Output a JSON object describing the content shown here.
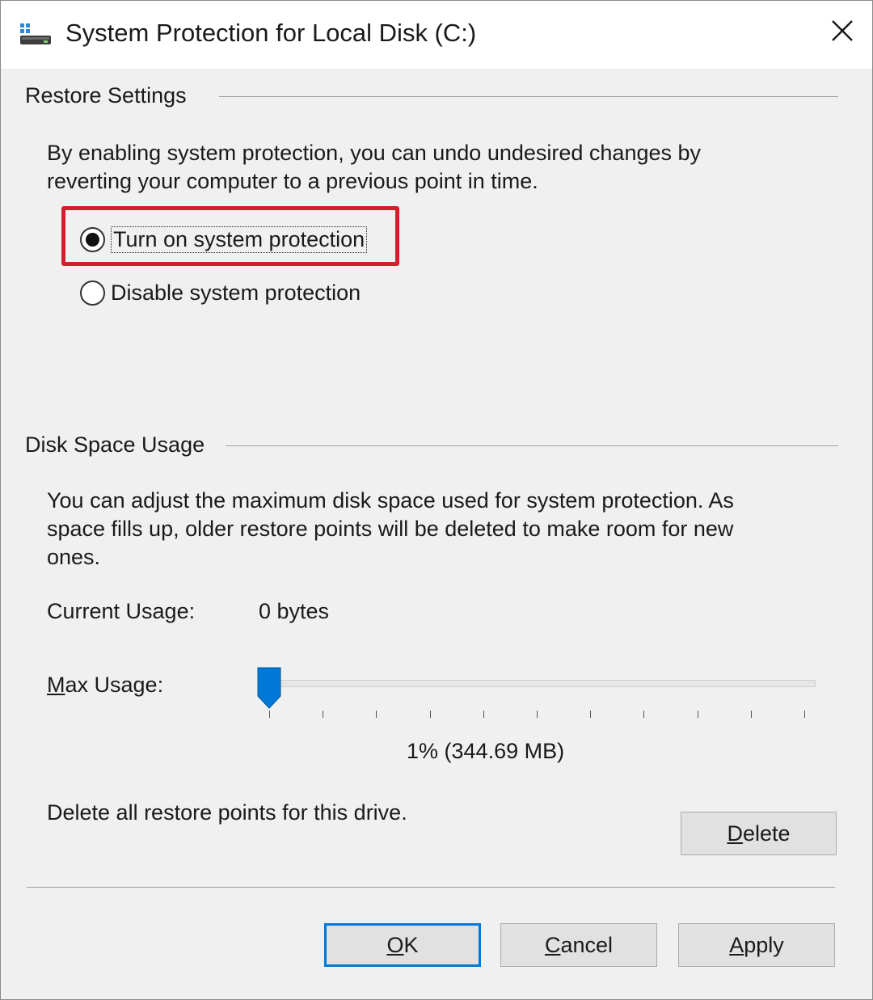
{
  "window": {
    "title": "System Protection for Local Disk (C:)",
    "icon": "drive-icon",
    "close_icon": "close-icon"
  },
  "restore_settings": {
    "group_label": "Restore Settings",
    "description_line1": "By enabling system protection, you can undo undesired changes by",
    "description_line2": "reverting your computer to a previous point in time.",
    "options": [
      {
        "label": "Turn on system protection",
        "selected": true,
        "highlighted": true
      },
      {
        "label": "Disable system protection",
        "selected": false
      }
    ],
    "highlight_color": "#d0202e"
  },
  "disk_space": {
    "group_label": "Disk Space Usage",
    "description_line1": "You can adjust the maximum disk space used for system protection. As",
    "description_line2": "space fills up, older restore points will be deleted to make room for new",
    "description_line3": "ones.",
    "current_usage_label": "Current Usage:",
    "current_usage_value": "0 bytes",
    "max_usage_label_first": "M",
    "max_usage_label_rest": "ax Usage:",
    "slider_percent": 1,
    "slider_value_text": "1% (344.69 MB)",
    "slider_accent": "#0078d7",
    "delete_text": "Delete all restore points for this drive.",
    "delete_button_first": "D",
    "delete_button_rest": "elete"
  },
  "footer": {
    "ok_first": "O",
    "ok_rest": "K",
    "cancel_first": "C",
    "cancel_rest": "ancel",
    "apply_first": "A",
    "apply_rest": "pply"
  }
}
